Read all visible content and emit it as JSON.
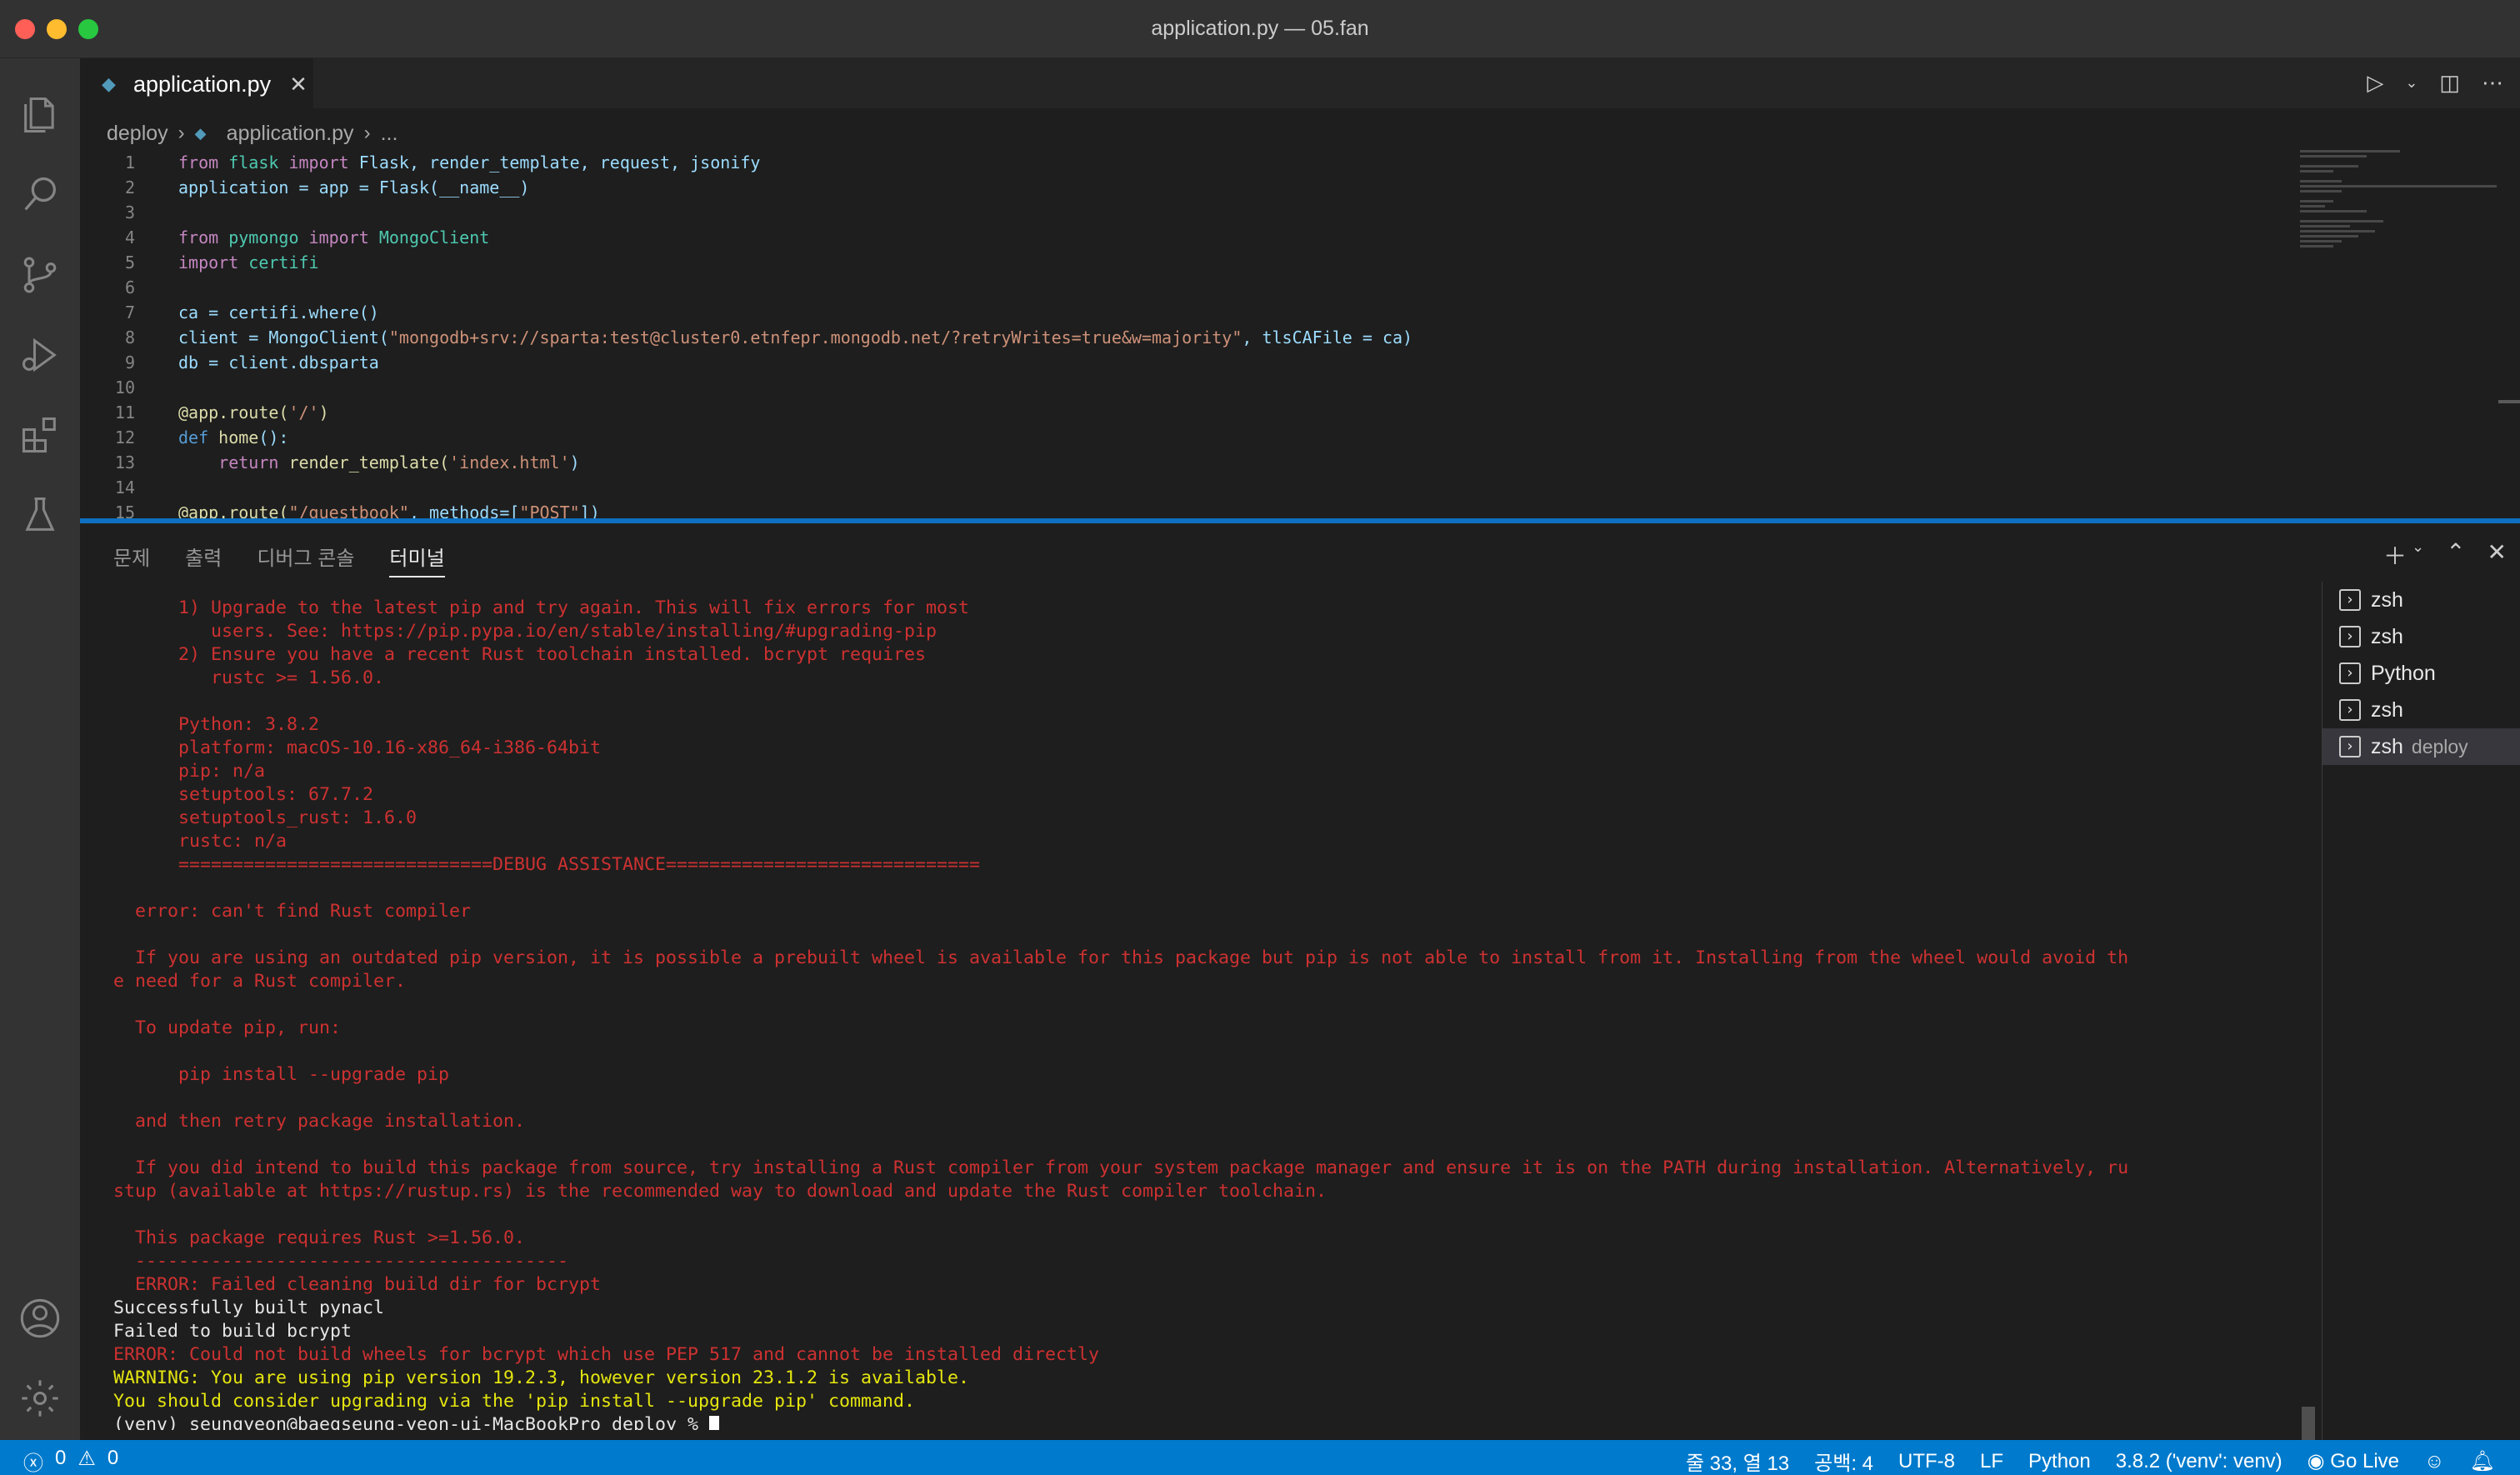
{
  "window": {
    "title": "application.py — 05.fan"
  },
  "activity_bar": {
    "icons": [
      "files-icon",
      "search-icon",
      "source-control-icon",
      "run-debug-icon",
      "extensions-icon",
      "testing-icon",
      "account-icon",
      "settings-gear-icon"
    ]
  },
  "editor": {
    "tab_label": "application.py",
    "tab_close": "✕",
    "breadcrumb": [
      "deploy",
      "application.py",
      "..."
    ],
    "line_numbers": [
      "1",
      "2",
      "3",
      "4",
      "5",
      "6",
      "7",
      "8",
      "9",
      "10",
      "11",
      "12",
      "13",
      "14",
      "15"
    ],
    "code": {
      "l1": [
        "from",
        " flask ",
        "import",
        " Flask, render_template, request, jsonify"
      ],
      "l2": "application = app = Flask(__name__)",
      "l4": [
        "from",
        " pymongo ",
        "import",
        " MongoClient"
      ],
      "l5": [
        "import",
        " certifi"
      ],
      "l7": "ca = certifi.where()",
      "l8a": "client = MongoClient(",
      "l8b": "\"mongodb+srv://sparta:test@cluster0.etnfepr.mongodb.net/?retryWrites=true&w=majority\"",
      "l8c": ", tlsCAFile = ca)",
      "l9": "db = client.dbsparta",
      "l11a": "@app.route(",
      "l11b": "'/'",
      "l11c": ")",
      "l12a": "def",
      "l12b": " home",
      "l12c": "():",
      "l13a": "    return",
      "l13b": " render_template(",
      "l13c": "'index.html'",
      "l13d": ")",
      "l15a": "@app.route(",
      "l15b": "\"/guestbook\"",
      "l15c": ", methods=[",
      "l15d": "\"POST\"",
      "l15e": "])"
    }
  },
  "panel": {
    "tabs": [
      "문제",
      "출력",
      "디버그 콘솔",
      "터미널"
    ],
    "active_tab": "터미널",
    "terminal_lines": [
      {
        "text": "      1) Upgrade to the latest pip and try again. This will fix errors for most",
        "color": "red"
      },
      {
        "text": "         users. See: https://pip.pypa.io/en/stable/installing/#upgrading-pip",
        "color": "red"
      },
      {
        "text": "      2) Ensure you have a recent Rust toolchain installed. bcrypt requires",
        "color": "red"
      },
      {
        "text": "         rustc >= 1.56.0.",
        "color": "red"
      },
      {
        "text": "",
        "color": "red"
      },
      {
        "text": "      Python: 3.8.2",
        "color": "red"
      },
      {
        "text": "      platform: macOS-10.16-x86_64-i386-64bit",
        "color": "red"
      },
      {
        "text": "      pip: n/a",
        "color": "red"
      },
      {
        "text": "      setuptools: 67.7.2",
        "color": "red"
      },
      {
        "text": "      setuptools_rust: 1.6.0",
        "color": "red"
      },
      {
        "text": "      rustc: n/a",
        "color": "red"
      },
      {
        "text": "      =============================DEBUG ASSISTANCE=============================",
        "color": "red"
      },
      {
        "text": "",
        "color": "red"
      },
      {
        "text": "  error: can't find Rust compiler",
        "color": "red"
      },
      {
        "text": "",
        "color": "red"
      },
      {
        "text": "  If you are using an outdated pip version, it is possible a prebuilt wheel is available for this package but pip is not able to install from it. Installing from the wheel would avoid th",
        "color": "red"
      },
      {
        "text": "e need for a Rust compiler.",
        "color": "red"
      },
      {
        "text": "",
        "color": "red"
      },
      {
        "text": "  To update pip, run:",
        "color": "red"
      },
      {
        "text": "",
        "color": "red"
      },
      {
        "text": "      pip install --upgrade pip",
        "color": "red"
      },
      {
        "text": "",
        "color": "red"
      },
      {
        "text": "  and then retry package installation.",
        "color": "red"
      },
      {
        "text": "",
        "color": "red"
      },
      {
        "text": "  If you did intend to build this package from source, try installing a Rust compiler from your system package manager and ensure it is on the PATH during installation. Alternatively, ru",
        "color": "red"
      },
      {
        "text": "stup (available at https://rustup.rs) is the recommended way to download and update the Rust compiler toolchain.",
        "color": "red"
      },
      {
        "text": "",
        "color": "red"
      },
      {
        "text": "  This package requires Rust >=1.56.0.",
        "color": "red"
      },
      {
        "text": "  ----------------------------------------",
        "color": "red"
      },
      {
        "text": "  ERROR: Failed cleaning build dir for bcrypt",
        "color": "red"
      },
      {
        "text": "Successfully built pynacl",
        "color": "white"
      },
      {
        "text": "Failed to build bcrypt",
        "color": "white"
      },
      {
        "text": "ERROR: Could not build wheels for bcrypt which use PEP 517 and cannot be installed directly",
        "color": "red"
      },
      {
        "text": "WARNING: You are using pip version 19.2.3, however version 23.1.2 is available.",
        "color": "yellow"
      },
      {
        "text": "You should consider upgrading via the 'pip install --upgrade pip' command.",
        "color": "yellow"
      }
    ],
    "prompt": "(venv) seungyeon@baegseung-yeon-ui-MacBookPro deploy % ",
    "terminals": [
      {
        "name": "zsh",
        "sub": ""
      },
      {
        "name": "zsh",
        "sub": ""
      },
      {
        "name": "Python",
        "sub": ""
      },
      {
        "name": "zsh",
        "sub": ""
      },
      {
        "name": "zsh",
        "sub": "deploy"
      }
    ],
    "active_terminal_index": 4
  },
  "status_bar": {
    "errors": "0",
    "warnings": "0",
    "position": "줄 33, 열 13",
    "indent": "공백: 4",
    "encoding": "UTF-8",
    "eol": "LF",
    "language": "Python",
    "interpreter": "3.8.2 ('venv': venv)",
    "go_live": "Go Live"
  }
}
